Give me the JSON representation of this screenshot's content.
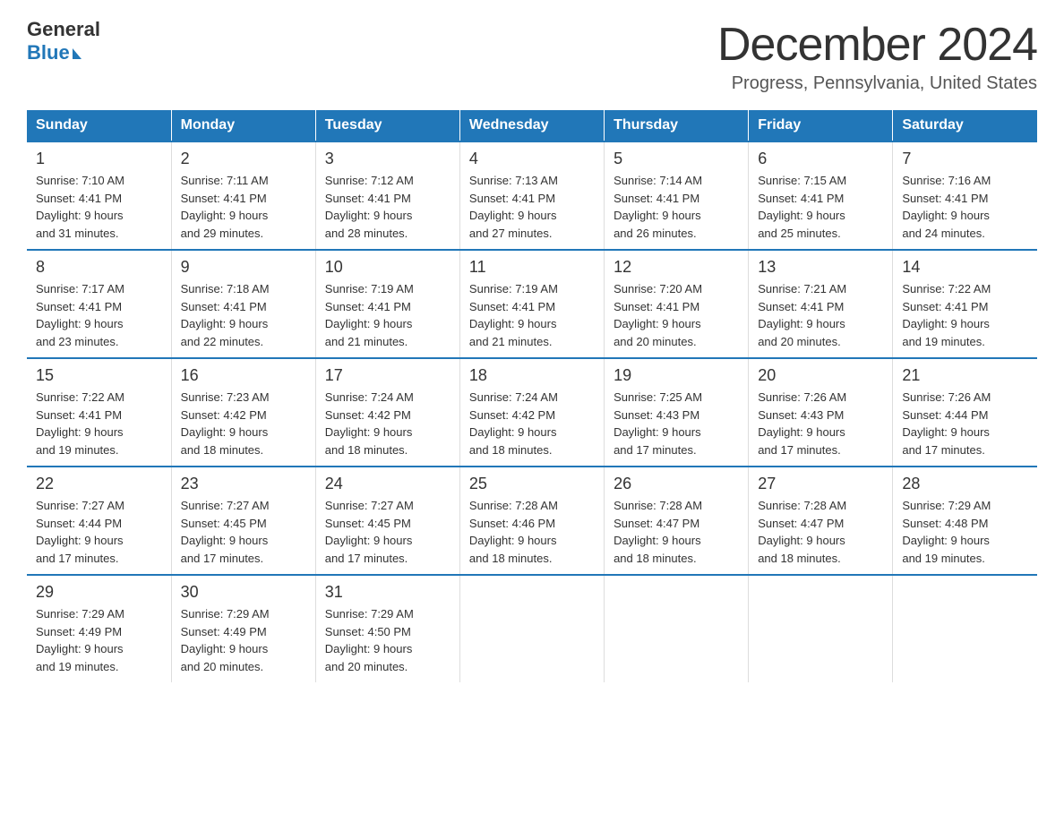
{
  "logo": {
    "general": "General",
    "blue": "Blue"
  },
  "header": {
    "month": "December 2024",
    "location": "Progress, Pennsylvania, United States"
  },
  "days_of_week": [
    "Sunday",
    "Monday",
    "Tuesday",
    "Wednesday",
    "Thursday",
    "Friday",
    "Saturday"
  ],
  "weeks": [
    [
      {
        "day": "1",
        "sunrise": "7:10 AM",
        "sunset": "4:41 PM",
        "daylight": "9 hours and 31 minutes."
      },
      {
        "day": "2",
        "sunrise": "7:11 AM",
        "sunset": "4:41 PM",
        "daylight": "9 hours and 29 minutes."
      },
      {
        "day": "3",
        "sunrise": "7:12 AM",
        "sunset": "4:41 PM",
        "daylight": "9 hours and 28 minutes."
      },
      {
        "day": "4",
        "sunrise": "7:13 AM",
        "sunset": "4:41 PM",
        "daylight": "9 hours and 27 minutes."
      },
      {
        "day": "5",
        "sunrise": "7:14 AM",
        "sunset": "4:41 PM",
        "daylight": "9 hours and 26 minutes."
      },
      {
        "day": "6",
        "sunrise": "7:15 AM",
        "sunset": "4:41 PM",
        "daylight": "9 hours and 25 minutes."
      },
      {
        "day": "7",
        "sunrise": "7:16 AM",
        "sunset": "4:41 PM",
        "daylight": "9 hours and 24 minutes."
      }
    ],
    [
      {
        "day": "8",
        "sunrise": "7:17 AM",
        "sunset": "4:41 PM",
        "daylight": "9 hours and 23 minutes."
      },
      {
        "day": "9",
        "sunrise": "7:18 AM",
        "sunset": "4:41 PM",
        "daylight": "9 hours and 22 minutes."
      },
      {
        "day": "10",
        "sunrise": "7:19 AM",
        "sunset": "4:41 PM",
        "daylight": "9 hours and 21 minutes."
      },
      {
        "day": "11",
        "sunrise": "7:19 AM",
        "sunset": "4:41 PM",
        "daylight": "9 hours and 21 minutes."
      },
      {
        "day": "12",
        "sunrise": "7:20 AM",
        "sunset": "4:41 PM",
        "daylight": "9 hours and 20 minutes."
      },
      {
        "day": "13",
        "sunrise": "7:21 AM",
        "sunset": "4:41 PM",
        "daylight": "9 hours and 20 minutes."
      },
      {
        "day": "14",
        "sunrise": "7:22 AM",
        "sunset": "4:41 PM",
        "daylight": "9 hours and 19 minutes."
      }
    ],
    [
      {
        "day": "15",
        "sunrise": "7:22 AM",
        "sunset": "4:41 PM",
        "daylight": "9 hours and 19 minutes."
      },
      {
        "day": "16",
        "sunrise": "7:23 AM",
        "sunset": "4:42 PM",
        "daylight": "9 hours and 18 minutes."
      },
      {
        "day": "17",
        "sunrise": "7:24 AM",
        "sunset": "4:42 PM",
        "daylight": "9 hours and 18 minutes."
      },
      {
        "day": "18",
        "sunrise": "7:24 AM",
        "sunset": "4:42 PM",
        "daylight": "9 hours and 18 minutes."
      },
      {
        "day": "19",
        "sunrise": "7:25 AM",
        "sunset": "4:43 PM",
        "daylight": "9 hours and 17 minutes."
      },
      {
        "day": "20",
        "sunrise": "7:26 AM",
        "sunset": "4:43 PM",
        "daylight": "9 hours and 17 minutes."
      },
      {
        "day": "21",
        "sunrise": "7:26 AM",
        "sunset": "4:44 PM",
        "daylight": "9 hours and 17 minutes."
      }
    ],
    [
      {
        "day": "22",
        "sunrise": "7:27 AM",
        "sunset": "4:44 PM",
        "daylight": "9 hours and 17 minutes."
      },
      {
        "day": "23",
        "sunrise": "7:27 AM",
        "sunset": "4:45 PM",
        "daylight": "9 hours and 17 minutes."
      },
      {
        "day": "24",
        "sunrise": "7:27 AM",
        "sunset": "4:45 PM",
        "daylight": "9 hours and 17 minutes."
      },
      {
        "day": "25",
        "sunrise": "7:28 AM",
        "sunset": "4:46 PM",
        "daylight": "9 hours and 18 minutes."
      },
      {
        "day": "26",
        "sunrise": "7:28 AM",
        "sunset": "4:47 PM",
        "daylight": "9 hours and 18 minutes."
      },
      {
        "day": "27",
        "sunrise": "7:28 AM",
        "sunset": "4:47 PM",
        "daylight": "9 hours and 18 minutes."
      },
      {
        "day": "28",
        "sunrise": "7:29 AM",
        "sunset": "4:48 PM",
        "daylight": "9 hours and 19 minutes."
      }
    ],
    [
      {
        "day": "29",
        "sunrise": "7:29 AM",
        "sunset": "4:49 PM",
        "daylight": "9 hours and 19 minutes."
      },
      {
        "day": "30",
        "sunrise": "7:29 AM",
        "sunset": "4:49 PM",
        "daylight": "9 hours and 20 minutes."
      },
      {
        "day": "31",
        "sunrise": "7:29 AM",
        "sunset": "4:50 PM",
        "daylight": "9 hours and 20 minutes."
      },
      null,
      null,
      null,
      null
    ]
  ],
  "labels": {
    "sunrise": "Sunrise:",
    "sunset": "Sunset:",
    "daylight": "Daylight:"
  }
}
